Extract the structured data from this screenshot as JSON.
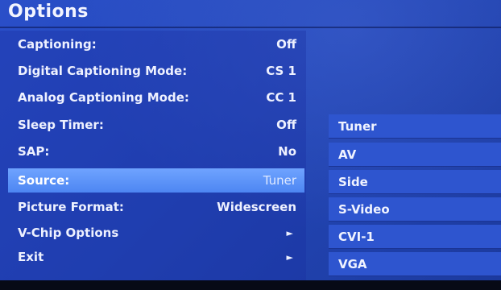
{
  "title": "Options",
  "menu": {
    "items": [
      {
        "label": "Captioning:",
        "value": "Off"
      },
      {
        "label": "Digital Captioning Mode:",
        "value": "CS 1"
      },
      {
        "label": "Analog Captioning Mode:",
        "value": "CC 1"
      },
      {
        "label": "Sleep Timer:",
        "value": "Off"
      },
      {
        "label": "SAP:",
        "value": "No"
      },
      {
        "label": "Source:",
        "value": "Tuner"
      },
      {
        "label": "Picture Format:",
        "value": "Widescreen"
      },
      {
        "label": "V-Chip Options",
        "value": "►"
      },
      {
        "label": "Exit",
        "value": "►"
      }
    ],
    "selected_label": "Source:"
  },
  "source_submenu": {
    "items": [
      "Tuner",
      "AV",
      "Side",
      "S-Video",
      "CVI-1",
      "VGA"
    ]
  },
  "colors": {
    "background": "#2347b8",
    "selected_row": "#5a91f7",
    "submenu_item": "#2e55cf",
    "text": "#eef1ff"
  }
}
